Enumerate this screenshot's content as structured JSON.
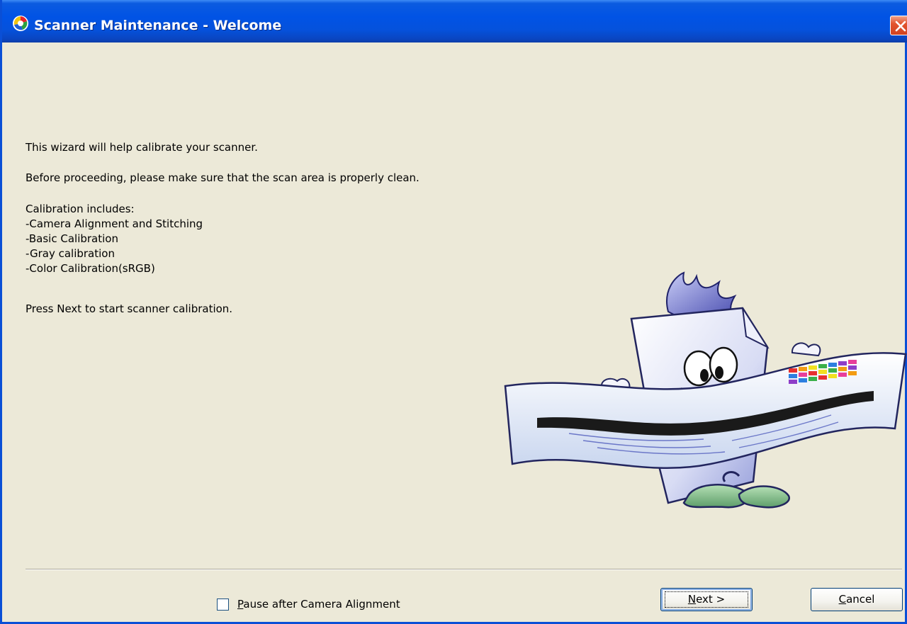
{
  "window": {
    "title": "Scanner Maintenance - Welcome",
    "title_icon": "scanner-app-icon",
    "close_icon": "close-icon"
  },
  "body": {
    "intro": "This wizard will help calibrate your scanner.",
    "clean_note": "Before proceeding, please make sure that the scan area is properly clean.",
    "includes_heading": "Calibration includes:",
    "includes": [
      "-Camera Alignment and Stitching",
      "-Basic Calibration",
      "-Gray calibration",
      "-Color Calibration(sRGB)"
    ],
    "press_next": "Press Next to start scanner calibration."
  },
  "footer": {
    "pause_checkbox": {
      "label_first": "P",
      "label_rest": "ause after Camera Alignment",
      "checked": false
    },
    "next_button": {
      "label_first": "N",
      "label_rest": "ext >"
    },
    "cancel_button": {
      "label_first": "C",
      "label_rest": "ancel"
    }
  },
  "colors": {
    "titlebar": "#0153e5",
    "dialog_bg": "#ece9d8",
    "close_button": "#e2542e"
  }
}
